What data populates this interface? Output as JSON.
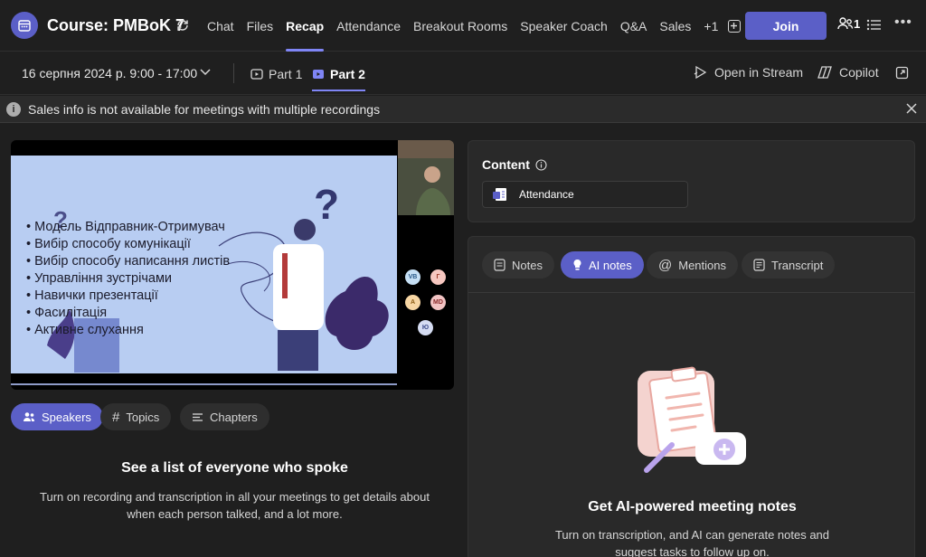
{
  "header": {
    "title": "Course: PMBoK 7",
    "tabs": [
      {
        "label": "Chat"
      },
      {
        "label": "Files"
      },
      {
        "label": "Recap"
      },
      {
        "label": "Attendance"
      },
      {
        "label": "Breakout Rooms"
      },
      {
        "label": "Speaker Coach"
      },
      {
        "label": "Q&A"
      },
      {
        "label": "Sales"
      },
      {
        "label": "+1"
      }
    ],
    "active_tab": "Recap",
    "join_label": "Join",
    "participants_count": "1"
  },
  "subbar": {
    "date": "16 серпня 2024 р. 9:00 - 17:00",
    "parts": [
      {
        "label": "Part 1"
      },
      {
        "label": "Part 2"
      }
    ],
    "active_part": "Part 2",
    "open_stream_label": "Open in Stream",
    "copilot_label": "Copilot"
  },
  "infobar": {
    "message": "Sales info is not available for meetings with multiple recordings"
  },
  "video": {
    "slide_bullets": [
      "Модель Відправник-Отримувач",
      "Вибір способу комунікації",
      "Вибір способу написання листів",
      "Управління зустрічами",
      "Навички презентації",
      "Фасилітація",
      "Активне слухання"
    ],
    "participants": [
      {
        "initials": "VB",
        "color": "#c6e0f5",
        "text_color": "#2a5a8a"
      },
      {
        "initials": "Г",
        "color": "#f6c7c0",
        "text_color": "#9a3b2a"
      },
      {
        "initials": "A",
        "color": "#f8d7a4",
        "text_color": "#8a5a12"
      },
      {
        "initials": "MD",
        "color": "#f2c4c4",
        "text_color": "#8a2a2a"
      },
      {
        "initials": "Ю",
        "color": "#d5dcf2",
        "text_color": "#3a4a8a"
      }
    ]
  },
  "left_pills": [
    {
      "label": "Speakers",
      "icon": "people-icon"
    },
    {
      "label": "Topics",
      "icon": "hash-icon"
    },
    {
      "label": "Chapters",
      "icon": "lines-icon"
    }
  ],
  "speakers_empty": {
    "title": "See a list of everyone who spoke",
    "description": "Turn on recording and transcription in all your meetings to get details about when each person talked, and a lot more."
  },
  "content_panel": {
    "label": "Content",
    "attendance_label": "Attendance"
  },
  "notes_tabs": [
    {
      "label": "Notes",
      "icon": "notes-icon"
    },
    {
      "label": "AI notes",
      "icon": "lightbulb-icon"
    },
    {
      "label": "Mentions",
      "icon": "at-icon"
    },
    {
      "label": "Transcript",
      "icon": "transcript-icon"
    }
  ],
  "ai_empty": {
    "title": "Get AI-powered meeting notes",
    "description": "Turn on transcription, and AI can generate notes and suggest tasks to follow up on."
  },
  "colors": {
    "accent": "#5b5fc7",
    "accent_underline": "#7f85f5",
    "background": "#1f1f1f",
    "card": "#292929"
  }
}
